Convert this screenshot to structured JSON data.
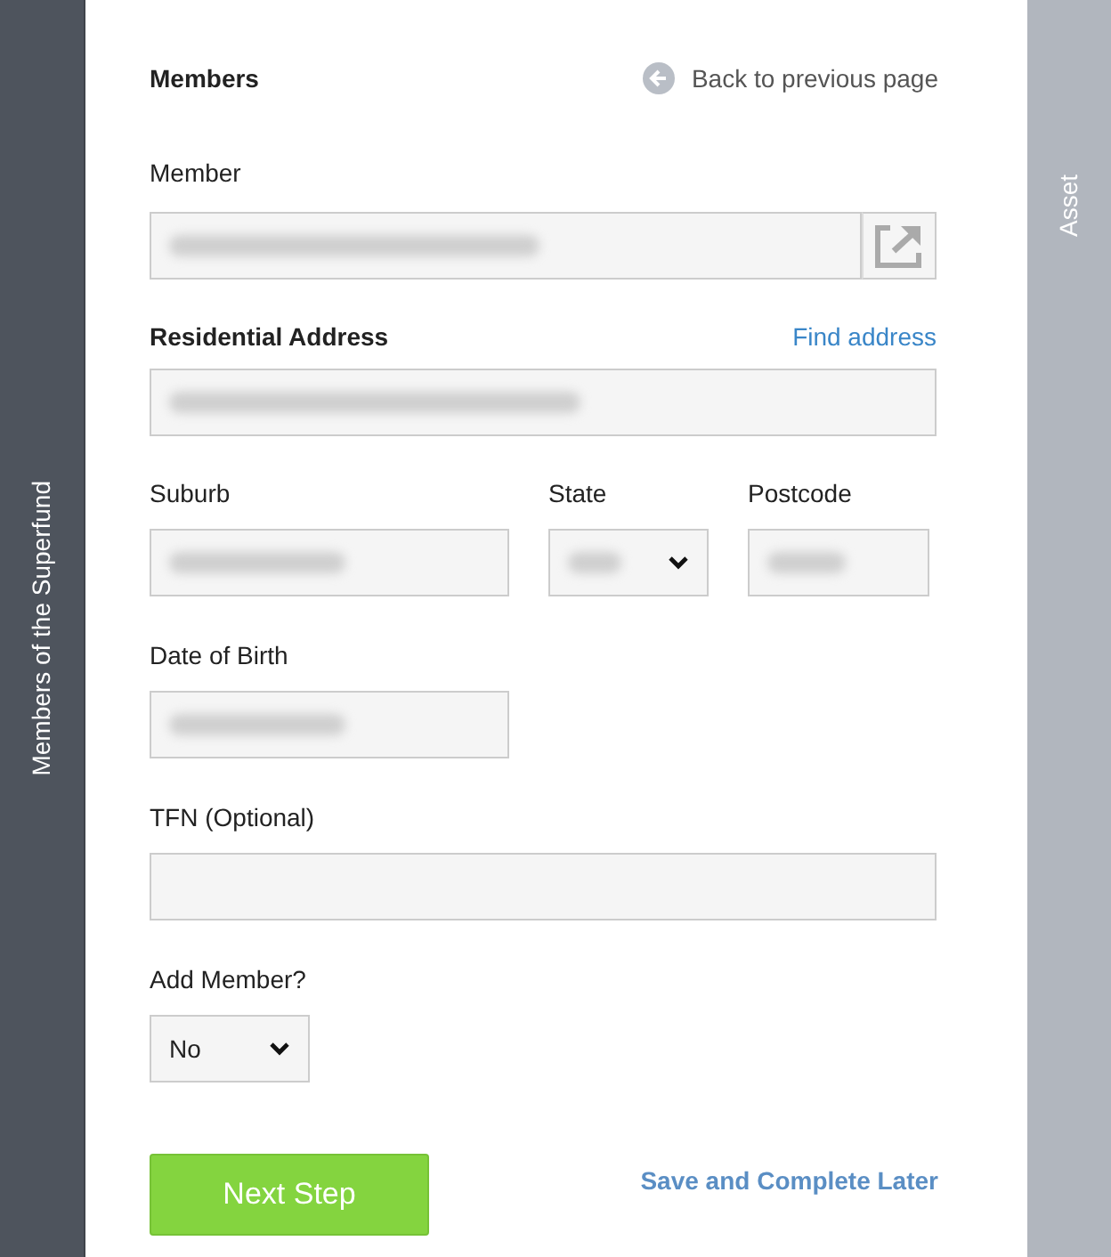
{
  "left_tab": {
    "label": "Members of the Superfund"
  },
  "right_tab": {
    "label": "Asset"
  },
  "header": {
    "title": "Members",
    "back_link": "Back to previous page"
  },
  "member": {
    "label": "Member",
    "blurred": true
  },
  "address": {
    "label": "Residential Address",
    "link": "Find address",
    "blurred": true
  },
  "row_fields": [
    {
      "kind": "input",
      "label": "Suburb",
      "blurred": true
    },
    {
      "kind": "select",
      "label": "State",
      "blurred": true
    },
    {
      "kind": "input",
      "label": "Postcode",
      "blurred": true
    }
  ],
  "dob": {
    "label": "Date of Birth",
    "blurred": true
  },
  "tfn": {
    "label": "TFN (Optional)",
    "blurred": false
  },
  "add_member": {
    "label": "Add Member?",
    "value": "No"
  },
  "actions": {
    "next": "Next Step",
    "save": "Save and Complete Later"
  }
}
